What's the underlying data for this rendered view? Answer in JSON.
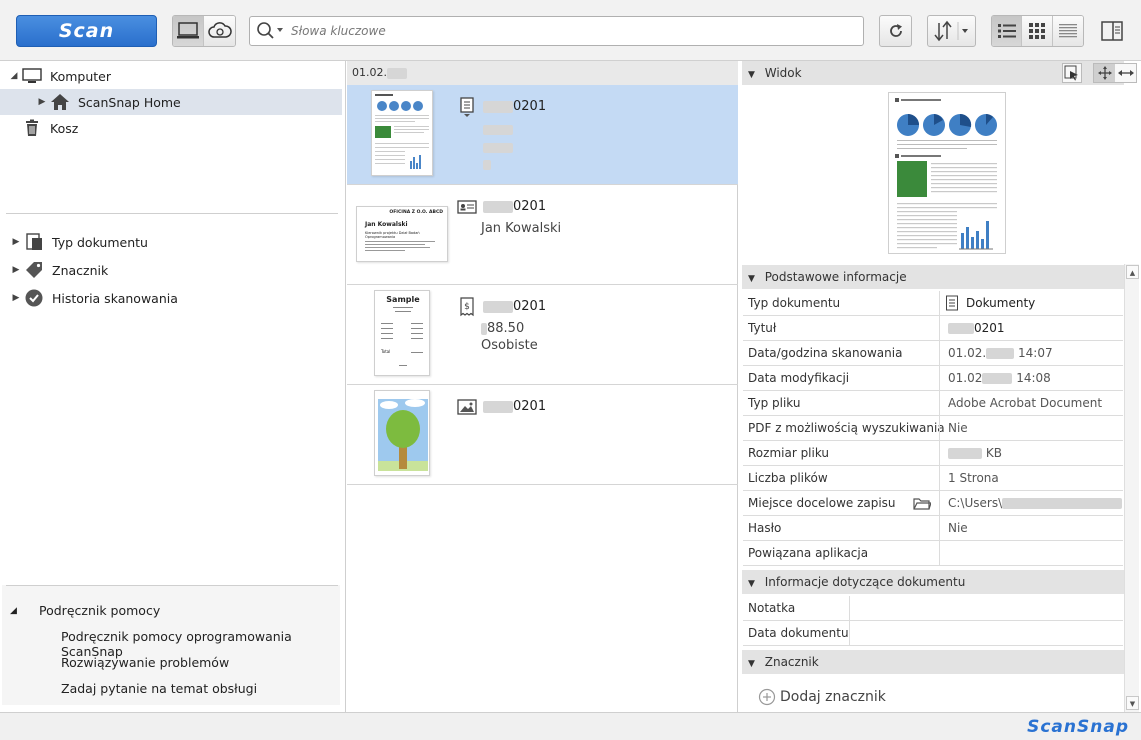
{
  "toolbar": {
    "scan_label": "Scan",
    "search_placeholder": "Słowa kluczowe",
    "icons": {
      "local_view": "computer-icon",
      "cloud_view": "cloud-sync-icon",
      "search": "search-icon",
      "refresh": "refresh-icon",
      "sort": "sort-icon",
      "list_view": "list-view-icon",
      "thumb_view": "grid-view-icon",
      "detail_view": "detail-view-icon",
      "panel_toggle": "panel-layout-icon"
    }
  },
  "sidebar": {
    "tree": [
      {
        "label": "Komputer",
        "icon": "monitor-icon"
      },
      {
        "label": "ScanSnap Home",
        "icon": "home-icon"
      },
      {
        "label": "Kosz",
        "icon": "trash-icon"
      }
    ],
    "filters": [
      {
        "label": "Typ dokumentu",
        "icon": "document-type-icon"
      },
      {
        "label": "Znacznik",
        "icon": "tag-icon"
      },
      {
        "label": "Historia skanowania",
        "icon": "check-history-icon"
      }
    ],
    "help": {
      "title": "Podręcznik pomocy",
      "items": [
        "Podręcznik pomocy oprogramowania ScanSnap",
        "Rozwiązywanie problemów",
        "Zadaj pytanie na temat obsługi"
      ]
    }
  },
  "list": {
    "date_header": "01.02.",
    "items": [
      {
        "name_suffix": "0201",
        "type_icon": "document-icon",
        "sub1": "",
        "sub2": ""
      },
      {
        "name_suffix": "0201",
        "type_icon": "business-card-icon",
        "sub1": "Jan Kowalski",
        "sub2": ""
      },
      {
        "name_suffix": "0201",
        "type_icon": "receipt-icon",
        "sub1": "88.50",
        "sub2": "Osobiste"
      },
      {
        "name_suffix": "0201",
        "type_icon": "photo-icon",
        "sub1": "",
        "sub2": ""
      }
    ],
    "card_thumb": {
      "company": "OFICINA Z O.O. ABCD",
      "name": "Jan Kowalski",
      "role": "Kierownik projektu Dział Badań Oprogramowania"
    },
    "receipt_thumb": {
      "title": "Sample",
      "total_label": "Total"
    }
  },
  "details": {
    "view_section": "Widok",
    "basic_section": "Podstawowe informacje",
    "basic": [
      {
        "key": "Typ dokumentu",
        "value": "Dokumenty"
      },
      {
        "key": "Tytuł",
        "value": "0201"
      },
      {
        "key": "Data/godzina skanowania",
        "value_prefix": "01.02.",
        "value": "14:07"
      },
      {
        "key": "Data modyfikacji",
        "value_prefix": "01.02",
        "value": "14:08"
      },
      {
        "key": "Typ pliku",
        "value": "Adobe Acrobat Document"
      },
      {
        "key": "PDF z możliwością wyszukiwania",
        "value": "Nie"
      },
      {
        "key": "Rozmiar pliku",
        "value": "KB"
      },
      {
        "key": "Liczba plików",
        "value": "1 Strona"
      },
      {
        "key": "Miejsce docelowe zapisu",
        "value": "C:\\Users\\"
      },
      {
        "key": "Hasło",
        "value": "Nie"
      },
      {
        "key": "Powiązana aplikacja",
        "value": ""
      }
    ],
    "doc_section": "Informacje dotyczące dokumentu",
    "doc": [
      {
        "key": "Notatka",
        "value": ""
      },
      {
        "key": "Data dokumentu",
        "value": ""
      }
    ],
    "tag_section": "Znacznik",
    "add_tag": "Dodaj znacznik"
  },
  "status": {
    "brand": "ScanSnap"
  },
  "colors": {
    "accent": "#2a72d2",
    "selection": "#c4daf4",
    "tree_selection": "#dde3ec"
  }
}
